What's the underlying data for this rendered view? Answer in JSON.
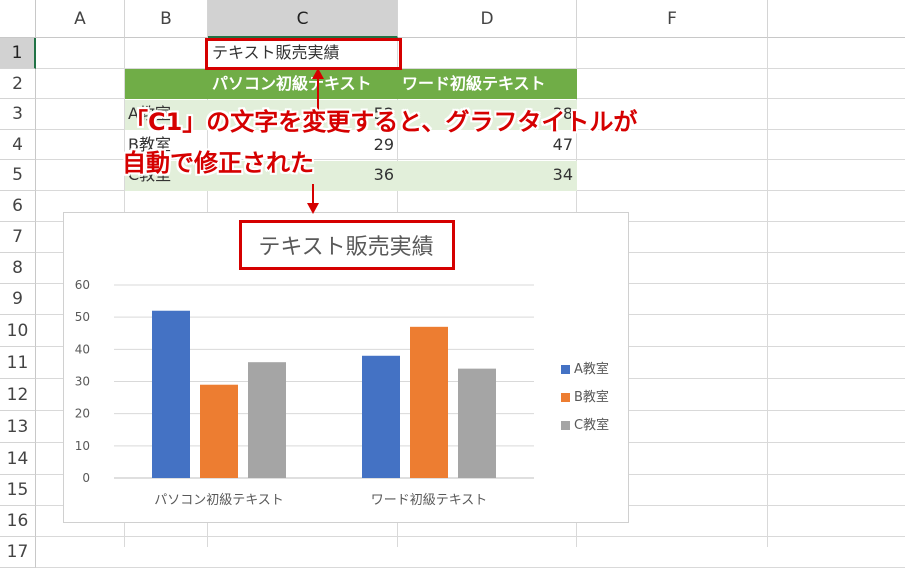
{
  "columns": [
    "A",
    "B",
    "C",
    "D",
    "F"
  ],
  "rows": [
    "1",
    "2",
    "3",
    "4",
    "5",
    "6",
    "7",
    "8",
    "9",
    "10",
    "11",
    "12",
    "13",
    "14",
    "15",
    "16",
    "17"
  ],
  "cells": {
    "c1": "テキスト販売実績",
    "c2": "パソコン初級テキスト",
    "d2": "ワード初級テキスト",
    "b3": "A教室",
    "c3": "52",
    "d3": "38",
    "b4": "B教室",
    "c4": "29",
    "d4": "47",
    "b5": "C教室",
    "c5": "36",
    "d5": "34"
  },
  "callout": {
    "line1": "「C1」の文字を変更すると、グラフタイトルが",
    "line2": "自動で修正された"
  },
  "colors": {
    "header_fill": "#70ad47",
    "band_fill": "#e2efda",
    "annotation_red": "#d50000"
  },
  "chart_data": {
    "type": "bar",
    "title": "テキスト販売実績",
    "categories": [
      "パソコン初級テキスト",
      "ワード初級テキスト"
    ],
    "series": [
      {
        "name": "A教室",
        "values": [
          52,
          38
        ],
        "color": "#4472c4"
      },
      {
        "name": "B教室",
        "values": [
          29,
          47
        ],
        "color": "#ed7d31"
      },
      {
        "name": "C教室",
        "values": [
          36,
          34
        ],
        "color": "#a5a5a5"
      }
    ],
    "ylim": [
      0,
      60
    ],
    "yticks": [
      "0",
      "10",
      "20",
      "30",
      "40",
      "50",
      "60"
    ],
    "grid": true,
    "legend_position": "right"
  }
}
